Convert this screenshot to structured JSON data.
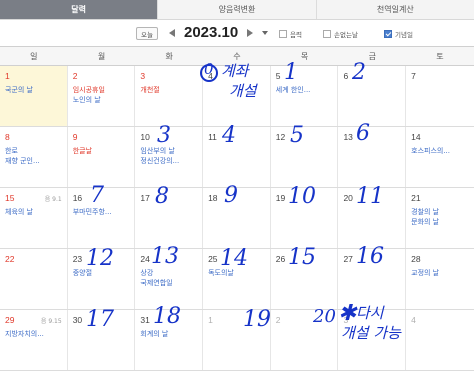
{
  "tabs": [
    {
      "label": "달력",
      "active": true
    },
    {
      "label": "양음력변환",
      "active": false
    },
    {
      "label": "천역일계산",
      "active": false
    }
  ],
  "toolbar": {
    "today_label": "오늘",
    "month_label": "2023.10",
    "options": [
      {
        "label": "음력",
        "checked": false
      },
      {
        "label": "손없는날",
        "checked": false
      },
      {
        "label": "기념일",
        "checked": true
      }
    ]
  },
  "calendar": {
    "weekdays": [
      "일",
      "월",
      "화",
      "수",
      "목",
      "금",
      "토"
    ],
    "weeks": [
      [
        {
          "day": "1",
          "color": "red",
          "today": true,
          "events": [
            {
              "text": "국군의 날",
              "color": "blue"
            }
          ]
        },
        {
          "day": "2",
          "color": "red",
          "events": [
            {
              "text": "임시공휴일",
              "color": "red"
            },
            {
              "text": "노인의 날",
              "color": "blue"
            }
          ]
        },
        {
          "day": "3",
          "color": "red",
          "events": [
            {
              "text": "개천절",
              "color": "red"
            }
          ]
        },
        {
          "day": "4",
          "events": []
        },
        {
          "day": "5",
          "events": [
            {
              "text": "세계 한인...",
              "color": "blue"
            }
          ]
        },
        {
          "day": "6",
          "events": []
        },
        {
          "day": "7",
          "events": []
        }
      ],
      [
        {
          "day": "8",
          "color": "red",
          "events": [
            {
              "text": "한로",
              "color": "blue"
            },
            {
              "text": "재향 군인...",
              "color": "blue"
            }
          ]
        },
        {
          "day": "9",
          "color": "red",
          "events": [
            {
              "text": "한글날",
              "color": "red"
            }
          ]
        },
        {
          "day": "10",
          "events": [
            {
              "text": "임산부의 날",
              "color": "blue"
            },
            {
              "text": "정신건강의...",
              "color": "blue"
            }
          ]
        },
        {
          "day": "11",
          "events": []
        },
        {
          "day": "12",
          "events": []
        },
        {
          "day": "13",
          "events": []
        },
        {
          "day": "14",
          "events": [
            {
              "text": "호스피스의...",
              "color": "blue"
            }
          ]
        }
      ],
      [
        {
          "day": "15",
          "color": "red",
          "lunar": "음 9.1",
          "events": [
            {
              "text": "체육의 날",
              "color": "blue"
            }
          ]
        },
        {
          "day": "16",
          "events": [
            {
              "text": "부마민주항...",
              "color": "blue"
            }
          ]
        },
        {
          "day": "17",
          "events": []
        },
        {
          "day": "18",
          "events": []
        },
        {
          "day": "19",
          "events": []
        },
        {
          "day": "20",
          "events": []
        },
        {
          "day": "21",
          "events": [
            {
              "text": "경찰의 날",
              "color": "blue"
            },
            {
              "text": "문화의 날",
              "color": "blue"
            }
          ]
        }
      ],
      [
        {
          "day": "22",
          "color": "red",
          "events": []
        },
        {
          "day": "23",
          "events": [
            {
              "text": "중양절",
              "color": "blue"
            }
          ]
        },
        {
          "day": "24",
          "events": [
            {
              "text": "상강",
              "color": "blue"
            },
            {
              "text": "국제연합일",
              "color": "blue"
            }
          ]
        },
        {
          "day": "25",
          "events": [
            {
              "text": "독도의날",
              "color": "blue"
            }
          ]
        },
        {
          "day": "26",
          "events": []
        },
        {
          "day": "27",
          "events": []
        },
        {
          "day": "28",
          "events": [
            {
              "text": "교정의 날",
              "color": "blue"
            }
          ]
        }
      ],
      [
        {
          "day": "29",
          "color": "red",
          "lunar": "음 9.15",
          "events": [
            {
              "text": "지방자치의...",
              "color": "blue"
            }
          ]
        },
        {
          "day": "30",
          "events": []
        },
        {
          "day": "31",
          "events": [
            {
              "text": "회계의 날",
              "color": "blue"
            }
          ]
        },
        {
          "day": "1",
          "color": "muted",
          "events": []
        },
        {
          "day": "2",
          "color": "muted",
          "events": []
        },
        {
          "day": "3",
          "color": "muted",
          "events": []
        },
        {
          "day": "4",
          "color": "muted",
          "events": []
        }
      ]
    ]
  },
  "handwriting": {
    "circled_zero": "0",
    "note_open": "계좌",
    "note_open_2": "개설",
    "numbers": [
      "1",
      "2",
      "3",
      "4",
      "5",
      "6",
      "7",
      "8",
      "9",
      "10",
      "11",
      "12",
      "13",
      "14",
      "15",
      "16",
      "17",
      "18",
      "19",
      "20"
    ],
    "star": "✱",
    "note_again": "다시",
    "note_again_2": "개설 가능",
    "ink_color": "#1633c8"
  }
}
